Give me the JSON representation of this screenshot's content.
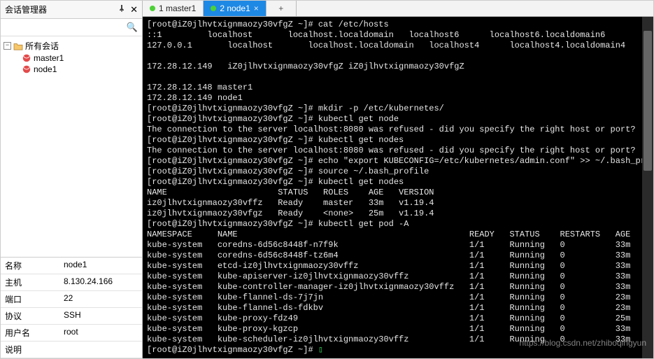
{
  "left_panel": {
    "title": "会话管理器",
    "search_placeholder": "",
    "root_label": "所有会话",
    "sessions": [
      {
        "label": "master1"
      },
      {
        "label": "node1"
      }
    ],
    "properties": {
      "name_k": "名称",
      "name_v": "node1",
      "host_k": "主机",
      "host_v": "8.130.24.166",
      "port_k": "端口",
      "port_v": "22",
      "proto_k": "协议",
      "proto_v": "SSH",
      "user_k": "用户名",
      "user_v": "root",
      "desc_k": "说明",
      "desc_v": ""
    }
  },
  "tabs": {
    "items": [
      {
        "label": "1 master1",
        "active": false
      },
      {
        "label": "2 node1",
        "active": true
      }
    ],
    "add": "+"
  },
  "terminal_text": "[root@iZ0jlhvtxignmaozy30vfgZ ~]# cat /etc/hosts\n::1         localhost       localhost.localdomain   localhost6      localhost6.localdomain6\n127.0.0.1       localhost       localhost.localdomain   localhost4      localhost4.localdomain4\n\n172.28.12.149   iZ0jlhvtxignmaozy30vfgZ iZ0jlhvtxignmaozy30vfgZ\n\n172.28.12.148 master1\n172.28.12.149 node1\n[root@iZ0jlhvtxignmaozy30vfgZ ~]# mkdir -p /etc/kubernetes/\n[root@iZ0jlhvtxignmaozy30vfgZ ~]# kubectl get node\nThe connection to the server localhost:8080 was refused - did you specify the right host or port?\n[root@iZ0jlhvtxignmaozy30vfgZ ~]# kubectl get nodes\nThe connection to the server localhost:8080 was refused - did you specify the right host or port?\n[root@iZ0jlhvtxignmaozy30vfgZ ~]# echo \"export KUBECONFIG=/etc/kubernetes/admin.conf\" >> ~/.bash_profile\n[root@iZ0jlhvtxignmaozy30vfgZ ~]# source ~/.bash_profile\n[root@iZ0jlhvtxignmaozy30vfgZ ~]# kubectl get nodes\nNAME                      STATUS   ROLES    AGE   VERSION\niz0jlhvtxignmaozy30vffz   Ready    master   33m   v1.19.4\niz0jlhvtxignmaozy30vfgz   Ready    <none>   25m   v1.19.4\n[root@iZ0jlhvtxignmaozy30vfgZ ~]# kubectl get pod -A\nNAMESPACE     NAME                                              READY   STATUS    RESTARTS   AGE\nkube-system   coredns-6d56c8448f-n7f9k                          1/1     Running   0          33m\nkube-system   coredns-6d56c8448f-tz6m4                          1/1     Running   0          33m\nkube-system   etcd-iz0jlhvtxignmaozy30vffz                      1/1     Running   0          33m\nkube-system   kube-apiserver-iz0jlhvtxignmaozy30vffz            1/1     Running   0          33m\nkube-system   kube-controller-manager-iz0jlhvtxignmaozy30vffz   1/1     Running   0          33m\nkube-system   kube-flannel-ds-7j7jn                             1/1     Running   0          23m\nkube-system   kube-flannel-ds-fdkbv                             1/1     Running   0          23m\nkube-system   kube-proxy-fdz49                                  1/1     Running   0          25m\nkube-system   kube-proxy-kgzcp                                  1/1     Running   0          33m\nkube-system   kube-scheduler-iz0jlhvtxignmaozy30vffz            1/1     Running   0          33m\n[root@iZ0jlhvtxignmaozy30vfgZ ~]# ",
  "cursor": "▯",
  "watermark": "https://blog.csdn.net/zhiboqingyun"
}
